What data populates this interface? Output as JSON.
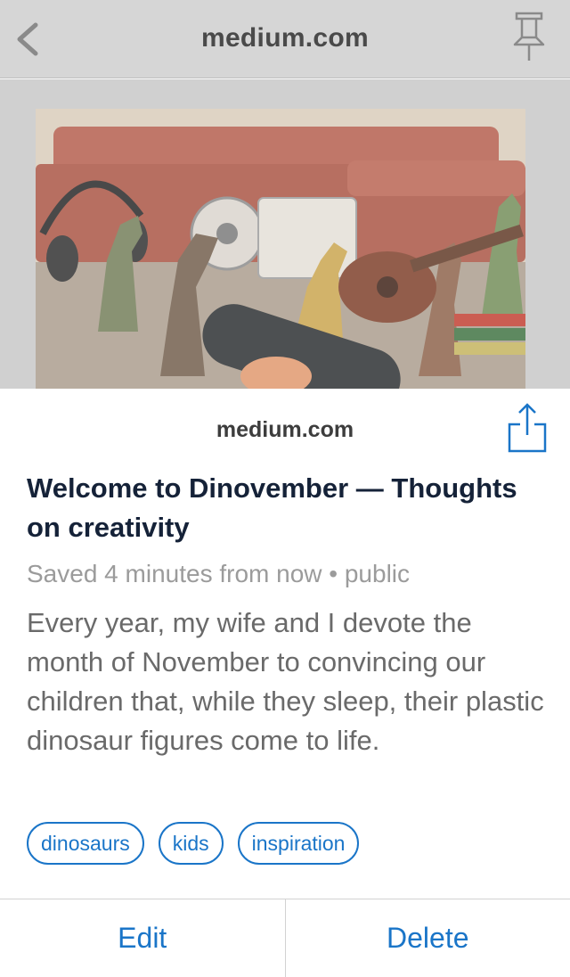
{
  "nav": {
    "title": "medium.com",
    "back_icon": "chevron-left-icon",
    "pin_icon": "pushpin-icon"
  },
  "hero": {
    "image": "photo of toy dinosaurs with headphones, microphone, tape reader and ukulele in front of a red sofa"
  },
  "sheet": {
    "domain": "medium.com",
    "share_icon": "share-icon",
    "title": "Welcome to Dinovember — Thoughts on creativity",
    "meta": "Saved 4 minutes from now • public",
    "excerpt": "Every year, my wife and I devote the month of November to convincing our children that, while they sleep, their plastic dinosaur figures come to life.",
    "tags": [
      "dinosaurs",
      "kids",
      "inspiration"
    ],
    "edit_label": "Edit",
    "delete_label": "Delete"
  },
  "colors": {
    "accent": "#1a75c8",
    "title_text": "#152238",
    "meta_text": "#9b9b9b",
    "body_text": "#6a6a6a",
    "dim_overlay": "#d0d0d0"
  }
}
